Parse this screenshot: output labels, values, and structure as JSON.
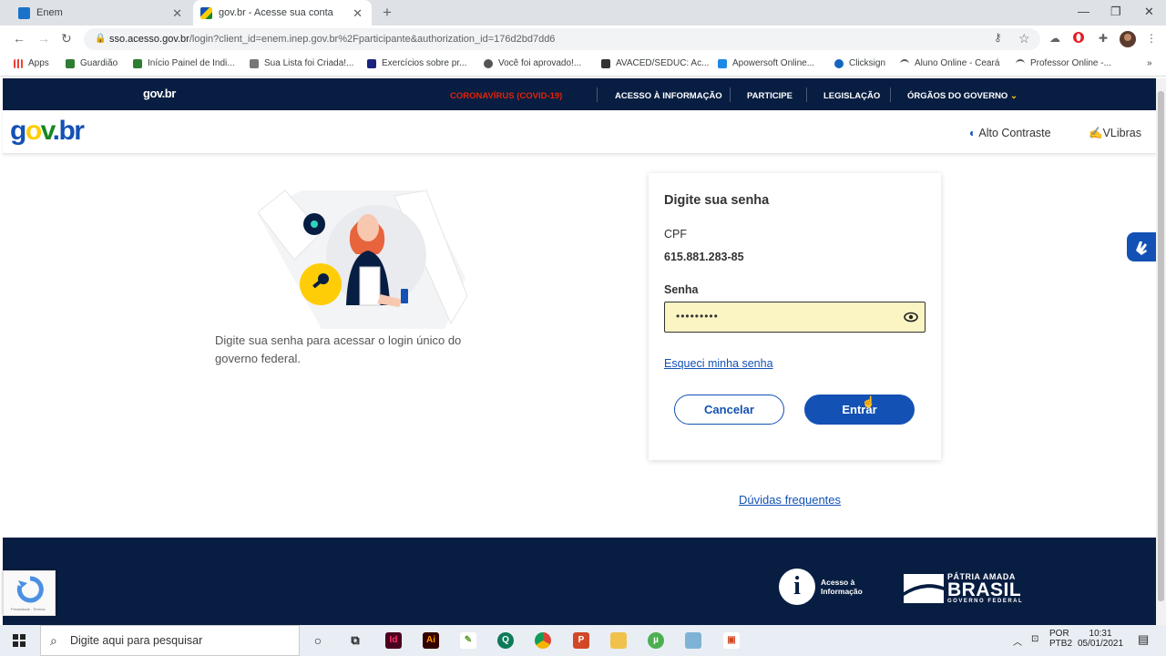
{
  "browser": {
    "tabs": [
      {
        "title": "Enem",
        "icon": "edge-icon"
      },
      {
        "title": "gov.br - Acesse sua conta",
        "icon": "govbr-favicon"
      }
    ],
    "url_domain": "sso.acesso.gov.br",
    "url_rest": "/login?client_id=enem.inep.gov.br%2Fparticipante&authorization_id=176d2bd7dd6",
    "bookmarks": [
      "Apps",
      "Guardião",
      "Início Painel de Indi...",
      "Sua Lista foi Criada!...",
      "Exercícios sobre pr...",
      "Você foi aprovado!...",
      "AVACED/SEDUC: Ac...",
      "Apowersoft Online...",
      "Clicksign",
      "Aluno Online - Ceará",
      "Professor Online -..."
    ],
    "bookmarks_more": "»"
  },
  "govbar": {
    "logo": "gov.br",
    "menu": {
      "covid": "CORONAVÍRUS (COVID-19)",
      "acesso": "ACESSO À INFORMAÇÃO",
      "participe": "PARTICIPE",
      "legislacao": "LEGISLAÇÃO",
      "orgaos": "ÓRGÃOS DO GOVERNO"
    },
    "covid_color": "#e52207"
  },
  "header": {
    "brand_g": "g",
    "brand_o": "o",
    "brand_v": "v",
    "brand_rest": ".br",
    "alto_contraste": "Alto Contraste",
    "vlibras": "VLibras"
  },
  "main": {
    "description": "Digite sua senha para acessar o login único do governo federal."
  },
  "login": {
    "title": "Digite sua senha",
    "cpf_label": "CPF",
    "cpf_value": "615.881.283-85",
    "senha_label": "Senha",
    "senha_value": "•••••••••",
    "forgot": "Esqueci minha senha",
    "cancel": "Cancelar",
    "enter": "Entrar"
  },
  "faq": "Dúvidas frequentes",
  "footer": {
    "acesso_line1": "Acesso à",
    "acesso_line2": "Informação",
    "patria_line1": "PÁTRIA AMADA",
    "patria_line2": "BRASIL",
    "patria_line3": "GOVERNO FEDERAL",
    "recaptcha_text": "Privacidade - Termos"
  },
  "taskbar": {
    "search_placeholder": "Digite aqui para pesquisar",
    "lang1": "POR",
    "lang2": "PTB2",
    "time": "10:31",
    "date": "05/01/2021"
  },
  "colors": {
    "gov_blue": "#1351b4",
    "dark_navy": "#071d41",
    "field_highlight": "#fbf5c4"
  }
}
